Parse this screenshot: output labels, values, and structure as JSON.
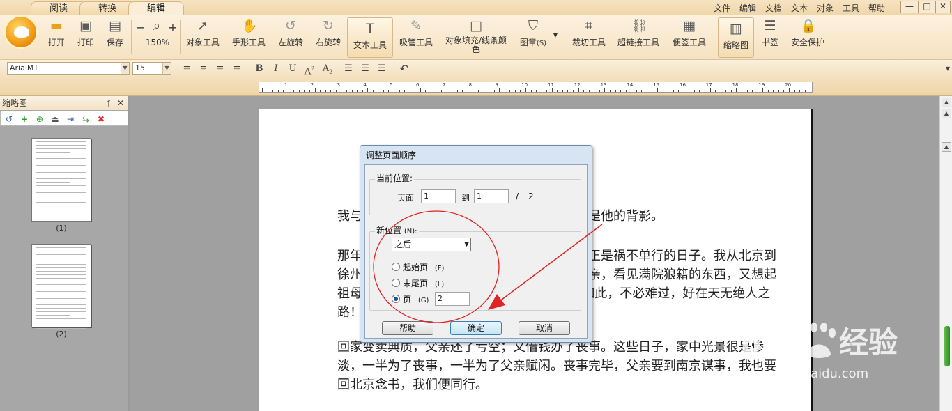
{
  "tabs": [
    "阅读",
    "转换",
    "编辑"
  ],
  "menu": [
    "文件",
    "编辑",
    "文档",
    "文本",
    "对象",
    "工具",
    "帮助"
  ],
  "window_controls": {
    "minimize": "—",
    "maximize": "□",
    "close": "✕"
  },
  "ribbon": {
    "open": "打开",
    "print": "打印",
    "save": "保存",
    "zoom_out": "−",
    "zoom_in": "+",
    "zoom_level": "150%",
    "object_tool": "对象工具",
    "hand_tool": "手形工具",
    "rotate_left": "左旋转",
    "rotate_right": "右旋转",
    "text_tool": "文本工具",
    "eyedropper": "吸管工具",
    "fill_line_1": "对象填充/线条颜",
    "fill_line_2": "色",
    "stamp": "图章",
    "stamp_key": "(S)",
    "crop": "裁切工具",
    "hyperlink": "超链接工具",
    "note": "便签工具",
    "thumbnails": "缩略图",
    "bookmarks": "书签",
    "security": "安全保护"
  },
  "format": {
    "font": "ArialMT",
    "size": "15",
    "bold": "B",
    "italic": "I",
    "underline": "U",
    "superscript": "A",
    "sup2": "2",
    "subscript": "A",
    "sub2": "2"
  },
  "ruler": {
    "numbers": [
      "1",
      "2",
      "3",
      "4",
      "5",
      "6",
      "7",
      "8",
      "9",
      "10",
      "11",
      "12",
      "13",
      "14",
      "15",
      "16",
      "17",
      "18",
      "19",
      "20"
    ]
  },
  "left_panel": {
    "title": "缩略图",
    "pin": "ᛘ",
    "close": "✕",
    "thumb_labels": [
      "(1)",
      "(2)"
    ]
  },
  "document": {
    "p1": "我与父亲不相见已二年余了，我最不能忘记的是他的背影。",
    "p2": "那年冬天，祖母死了，父亲的差使也交卸了，正是祸不单行的日子。我从北京到徐州，打算跟着父亲奔丧回家。到徐州见着父亲，看见满院狼籍的东西，又想起祖母，不禁簌簌地流下眼泪。父亲说：“事已如此，不必难过，好在天无绝人之路！”",
    "p3": "回家变卖典质，父亲还了亏空；又借钱办了丧事。这些日子，家中光景很是惨淡，一半为了丧事，一半为了父亲赋闲。丧事完毕，父亲要到南京谋事，我也要回北京念书，我们便同行。"
  },
  "dialog": {
    "title": "调整页面顺序",
    "current_group": "当前位置:",
    "page_label": "页面",
    "from_value": "1",
    "to_label": "到",
    "to_value": "1",
    "slash": "/",
    "total": "2",
    "new_group": "新位置",
    "new_key": "(N):",
    "position_select": "之后",
    "opt_first": "起始页",
    "opt_first_key": "(F)",
    "opt_last": "末尾页",
    "opt_last_key": "(L)",
    "opt_page": "页",
    "opt_page_key": "(G)",
    "page_value": "2",
    "btn_help": "帮助",
    "btn_ok": "确定",
    "btn_cancel": "取消"
  },
  "watermark": {
    "text": "jingyan.baidu.com"
  },
  "colors": {
    "annotation": "#e02424",
    "accent": "#f0d6a8"
  }
}
